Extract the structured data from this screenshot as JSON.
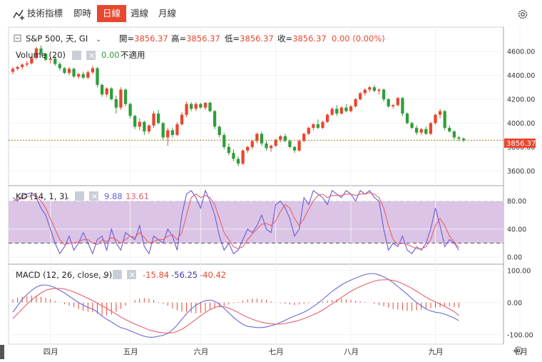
{
  "toolbar": {
    "indicators_label": "技術指標",
    "tabs": [
      {
        "label": "即時"
      },
      {
        "label": "日線",
        "active": true
      },
      {
        "label": "週線"
      },
      {
        "label": "月線"
      }
    ],
    "icons": [
      "indicators-icon",
      "settings-gear-icon"
    ]
  },
  "main_legend": {
    "symbol": "S&P 500, 天, GI",
    "open_label": "開=",
    "open": "3856.37",
    "high_label": "高=",
    "high": "3856.37",
    "low_label": "低=",
    "low": "3856.37",
    "close_label": "收=",
    "close": "3856.37",
    "change": "0.00 (0.00%)",
    "volume_label": "Volume (20)",
    "volume_value": "0.00",
    "volume_na": "不適用"
  },
  "kd_legend": {
    "label": "KD (14, 1, 3)",
    "k": "9.88",
    "d": "13.61"
  },
  "macd_legend": {
    "label": "MACD (12, 26, close, 9)",
    "v1": "-15.84",
    "v2": "-56.25",
    "v3": "-40.42"
  },
  "price_tag": "3856.37",
  "colors": {
    "up": "#e8472f",
    "down": "#2f9e3a",
    "k_line": "#6a5cd6",
    "d_line": "#e8606a",
    "kd_band": "#dcc4e6",
    "macd_line": "#6a6ad6",
    "signal_line": "#e8606a",
    "hist": "#e8472f",
    "accent": "#e8472f"
  },
  "chart_data": [
    {
      "type": "candlestick",
      "title": "S&P 500, 天, GI",
      "y_ticks": [
        "4600.00",
        "4400.00",
        "4200.00",
        "4000.00",
        "3800.00",
        "3600.00"
      ],
      "ylim": [
        3500,
        4720
      ],
      "x_tick_labels": [
        "四月",
        "五月",
        "六月",
        "七月",
        "八月",
        "九月",
        "十月"
      ],
      "last_value": 3856.37,
      "ohlc": [
        [
          4430,
          4470,
          4410,
          4455
        ],
        [
          4455,
          4480,
          4440,
          4470
        ],
        [
          4470,
          4500,
          4450,
          4490
        ],
        [
          4490,
          4520,
          4470,
          4500
        ],
        [
          4500,
          4560,
          4490,
          4545
        ],
        [
          4545,
          4640,
          4530,
          4625
        ],
        [
          4625,
          4650,
          4570,
          4580
        ],
        [
          4580,
          4590,
          4520,
          4530
        ],
        [
          4530,
          4555,
          4500,
          4540
        ],
        [
          4540,
          4560,
          4480,
          4495
        ],
        [
          4495,
          4510,
          4440,
          4460
        ],
        [
          4460,
          4470,
          4410,
          4420
        ],
        [
          4420,
          4470,
          4400,
          4455
        ],
        [
          4455,
          4465,
          4380,
          4390
        ],
        [
          4390,
          4420,
          4370,
          4410
        ],
        [
          4410,
          4430,
          4370,
          4380
        ],
        [
          4380,
          4440,
          4370,
          4425
        ],
        [
          4425,
          4480,
          4410,
          4460
        ],
        [
          4460,
          4470,
          4300,
          4320
        ],
        [
          4320,
          4330,
          4220,
          4240
        ],
        [
          4240,
          4300,
          4220,
          4290
        ],
        [
          4290,
          4300,
          4190,
          4200
        ],
        [
          4200,
          4230,
          4080,
          4130
        ],
        [
          4130,
          4300,
          4110,
          4280
        ],
        [
          4280,
          4290,
          4140,
          4160
        ],
        [
          4160,
          4170,
          4040,
          4060
        ],
        [
          4060,
          4070,
          3950,
          3970
        ],
        [
          3970,
          4040,
          3940,
          4010
        ],
        [
          4010,
          4020,
          3900,
          3930
        ],
        [
          3930,
          3990,
          3910,
          3980
        ],
        [
          3980,
          4100,
          3960,
          4080
        ],
        [
          4080,
          4110,
          3990,
          4000
        ],
        [
          4000,
          4010,
          3860,
          3880
        ],
        [
          3880,
          3960,
          3810,
          3940
        ],
        [
          3940,
          3960,
          3880,
          3900
        ],
        [
          3900,
          4010,
          3890,
          3990
        ],
        [
          3990,
          4090,
          3980,
          4070
        ],
        [
          4070,
          4180,
          4050,
          4160
        ],
        [
          4160,
          4175,
          4100,
          4120
        ],
        [
          4120,
          4175,
          4100,
          4160
        ],
        [
          4160,
          4170,
          4120,
          4130
        ],
        [
          4130,
          4175,
          4110,
          4170
        ],
        [
          4170,
          4180,
          4090,
          4100
        ],
        [
          4100,
          4110,
          3950,
          3970
        ],
        [
          3970,
          3980,
          3880,
          3900
        ],
        [
          3900,
          3920,
          3780,
          3800
        ],
        [
          3800,
          3830,
          3730,
          3750
        ],
        [
          3750,
          3780,
          3680,
          3700
        ],
        [
          3700,
          3720,
          3640,
          3660
        ],
        [
          3660,
          3780,
          3650,
          3770
        ],
        [
          3770,
          3810,
          3750,
          3800
        ],
        [
          3800,
          3860,
          3780,
          3850
        ],
        [
          3850,
          3920,
          3830,
          3910
        ],
        [
          3910,
          3930,
          3810,
          3830
        ],
        [
          3830,
          3850,
          3770,
          3790
        ],
        [
          3790,
          3820,
          3760,
          3810
        ],
        [
          3810,
          3870,
          3800,
          3860
        ],
        [
          3860,
          3900,
          3840,
          3890
        ],
        [
          3890,
          3910,
          3840,
          3850
        ],
        [
          3850,
          3860,
          3790,
          3800
        ],
        [
          3800,
          3810,
          3750,
          3770
        ],
        [
          3770,
          3860,
          3760,
          3850
        ],
        [
          3850,
          3920,
          3840,
          3910
        ],
        [
          3910,
          3970,
          3900,
          3960
        ],
        [
          3960,
          4000,
          3940,
          3990
        ],
        [
          3990,
          4030,
          3950,
          3960
        ],
        [
          3960,
          4020,
          3950,
          4010
        ],
        [
          4010,
          4080,
          4000,
          4070
        ],
        [
          4070,
          4130,
          4060,
          4120
        ],
        [
          4120,
          4150,
          4060,
          4080
        ],
        [
          4080,
          4140,
          4070,
          4130
        ],
        [
          4130,
          4160,
          4090,
          4100
        ],
        [
          4100,
          4150,
          4090,
          4140
        ],
        [
          4140,
          4210,
          4130,
          4200
        ],
        [
          4200,
          4260,
          4190,
          4250
        ],
        [
          4250,
          4290,
          4230,
          4280
        ],
        [
          4280,
          4310,
          4260,
          4300
        ],
        [
          4300,
          4320,
          4260,
          4270
        ],
        [
          4270,
          4290,
          4240,
          4280
        ],
        [
          4280,
          4290,
          4180,
          4200
        ],
        [
          4200,
          4210,
          4130,
          4140
        ],
        [
          4140,
          4160,
          4120,
          4150
        ],
        [
          4150,
          4220,
          4140,
          4210
        ],
        [
          4210,
          4220,
          4060,
          4080
        ],
        [
          4080,
          4090,
          3990,
          4000
        ],
        [
          4000,
          4010,
          3950,
          3960
        ],
        [
          3960,
          3980,
          3900,
          3920
        ],
        [
          3920,
          3960,
          3900,
          3950
        ],
        [
          3950,
          3970,
          3900,
          3910
        ],
        [
          3910,
          4010,
          3900,
          4000
        ],
        [
          4000,
          4080,
          3990,
          4070
        ],
        [
          4070,
          4120,
          4040,
          4100
        ],
        [
          4100,
          4110,
          3940,
          3960
        ],
        [
          3960,
          3980,
          3920,
          3930
        ],
        [
          3930,
          3940,
          3860,
          3880
        ],
        [
          3880,
          3890,
          3850,
          3870
        ],
        [
          3870,
          3880,
          3840,
          3856.37
        ]
      ]
    },
    {
      "type": "line",
      "title": "KD (14, 1, 3)",
      "y_ticks": [
        "80.00",
        "40.00",
        "0.00"
      ],
      "ylim": [
        -8,
        100
      ],
      "band": [
        20,
        80
      ],
      "series": [
        {
          "name": "K",
          "values": [
            85,
            80,
            88,
            90,
            92,
            85,
            70,
            60,
            40,
            20,
            5,
            15,
            30,
            10,
            20,
            35,
            20,
            5,
            25,
            30,
            10,
            40,
            20,
            10,
            35,
            30,
            25,
            45,
            15,
            5,
            30,
            25,
            20,
            40,
            30,
            10,
            60,
            90,
            95,
            85,
            70,
            95,
            80,
            60,
            30,
            10,
            20,
            5,
            10,
            25,
            40,
            35,
            45,
            60,
            40,
            35,
            75,
            80,
            70,
            55,
            30,
            40,
            85,
            75,
            95,
            90,
            85,
            75,
            95,
            90,
            85,
            95,
            90,
            80,
            95,
            90,
            95,
            85,
            80,
            40,
            10,
            20,
            15,
            30,
            10,
            5,
            15,
            10,
            20,
            40,
            70,
            45,
            15,
            25,
            20,
            9.88
          ]
        },
        {
          "name": "D",
          "values": [
            80,
            82,
            84,
            86,
            88,
            88,
            80,
            70,
            55,
            40,
            25,
            18,
            20,
            20,
            22,
            25,
            25,
            20,
            18,
            25,
            22,
            28,
            25,
            20,
            25,
            30,
            28,
            35,
            28,
            20,
            22,
            25,
            25,
            30,
            32,
            25,
            35,
            60,
            85,
            90,
            85,
            88,
            85,
            75,
            55,
            35,
            25,
            15,
            12,
            15,
            25,
            33,
            40,
            47,
            48,
            45,
            52,
            65,
            75,
            70,
            55,
            45,
            55,
            68,
            80,
            88,
            90,
            85,
            88,
            88,
            88,
            90,
            90,
            88,
            90,
            90,
            92,
            90,
            85,
            70,
            45,
            25,
            18,
            20,
            18,
            15,
            12,
            12,
            15,
            25,
            45,
            55,
            45,
            30,
            22,
            13.61
          ]
        }
      ]
    },
    {
      "type": "line",
      "title": "MACD (12, 26, close, 9)",
      "y_ticks": [
        "100.00",
        "0.00",
        "-100.00"
      ],
      "ylim": [
        -125,
        115
      ],
      "series": [
        {
          "name": "MACD",
          "values": [
            -30,
            -10,
            10,
            25,
            38,
            48,
            54,
            55,
            52,
            46,
            38,
            30,
            20,
            10,
            0,
            -8,
            -15,
            -20,
            -30,
            -42,
            -52,
            -60,
            -70,
            -78,
            -82,
            -88,
            -94,
            -100,
            -105,
            -108,
            -108,
            -105,
            -102,
            -96,
            -85,
            -70,
            -52,
            -35,
            -20,
            -8,
            0,
            6,
            8,
            4,
            -5,
            -18,
            -32,
            -46,
            -58,
            -68,
            -74,
            -76,
            -78,
            -78,
            -76,
            -72,
            -68,
            -62,
            -55,
            -48,
            -42,
            -36,
            -30,
            -22,
            -12,
            -2,
            10,
            22,
            35,
            45,
            55,
            63,
            70,
            76,
            82,
            87,
            90,
            90,
            86,
            80,
            72,
            62,
            50,
            38,
            26,
            12,
            0,
            -10,
            -20,
            -26,
            -30,
            -32,
            -36,
            -42,
            -48,
            -56.25
          ]
        },
        {
          "name": "Signal",
          "values": [
            -50,
            -35,
            -20,
            -5,
            8,
            20,
            30,
            38,
            42,
            44,
            44,
            42,
            38,
            33,
            27,
            20,
            13,
            6,
            -2,
            -10,
            -18,
            -27,
            -36,
            -45,
            -53,
            -60,
            -67,
            -73,
            -79,
            -85,
            -89,
            -92,
            -94,
            -95,
            -94,
            -90,
            -83,
            -74,
            -63,
            -52,
            -41,
            -31,
            -22,
            -15,
            -12,
            -13,
            -17,
            -24,
            -31,
            -39,
            -46,
            -52,
            -57,
            -61,
            -64,
            -66,
            -67,
            -67,
            -65,
            -62,
            -59,
            -55,
            -50,
            -44,
            -38,
            -31,
            -23,
            -14,
            -4,
            6,
            16,
            26,
            35,
            43,
            50,
            56,
            62,
            67,
            70,
            71,
            71,
            69,
            65,
            59,
            52,
            44,
            35,
            26,
            17,
            9,
            2,
            -5,
            -12,
            -20,
            -28,
            -40.42
          ]
        }
      ],
      "histogram": [
        10,
        15,
        18,
        20,
        22,
        20,
        18,
        15,
        10,
        5,
        0,
        -5,
        -10,
        -15,
        -20,
        -25,
        -28,
        -30,
        -35,
        -40,
        -40,
        -38,
        -30,
        -20,
        -10,
        0,
        8,
        12,
        14,
        12,
        8,
        2,
        -4,
        -10,
        -18,
        -24,
        -28,
        -30,
        -32,
        -34,
        -32,
        -28,
        -22,
        -18,
        -14,
        -10,
        -6,
        -2,
        2,
        6,
        10,
        12,
        12,
        10,
        8,
        4,
        0,
        -2,
        -4,
        -6,
        -8,
        -6,
        -4,
        -2,
        0,
        2,
        4,
        6,
        8,
        10,
        12,
        10,
        8,
        6,
        4,
        2,
        0,
        -4,
        -8,
        -12,
        -16,
        -20,
        -22,
        -24,
        -26,
        -26,
        -24,
        -22,
        -20,
        -18,
        -16,
        -14,
        -12,
        -12,
        -14,
        -15.84
      ]
    }
  ]
}
